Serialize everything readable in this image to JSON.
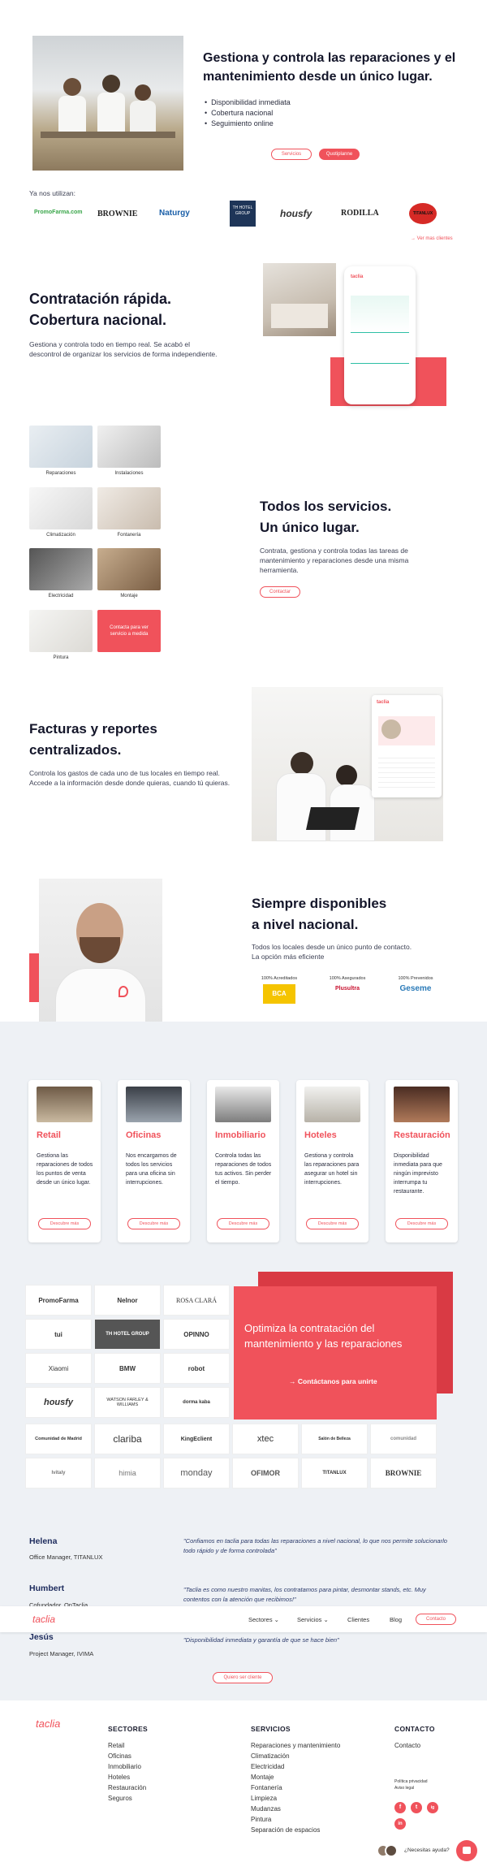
{
  "hero": {
    "title": "Gestiona y controla las reparaciones y el mantenimiento desde un único lugar.",
    "bullets": [
      "Disponibilidad inmediata",
      "Cobertura nacional",
      "Seguimiento online"
    ],
    "btn_services": "Servicios",
    "btn_quote": "Quotiplanne"
  },
  "clients": {
    "label": "Ya nos utilizan:",
    "logos": [
      "PromoFarma.com",
      "BROWNIE",
      "Naturgy",
      "TH HOTEL GROUP",
      "housfy",
      "RODILLA",
      "TITANLUX"
    ],
    "more": "→ Ver mas clientes"
  },
  "s1": {
    "title_1": "Contratación rápida.",
    "title_2": "Cobertura nacional.",
    "text": "Gestiona y controla todo en tiempo real. Se acabó el descontrol de organizar los servicios de forma independiente."
  },
  "services": {
    "items": [
      "Reparaciones",
      "Instalaciones",
      "Climatización",
      "Fontanería",
      "Electricidad",
      "Montaje",
      "Pintura"
    ],
    "contact_tile": "Contacta para ver servicio a medida",
    "title_1": "Todos los servicios.",
    "title_2": "Un único lugar.",
    "text": "Contrata, gestiona y controla todas las tareas de mantenimiento y reparaciones desde una misma herramienta.",
    "btn": "Contactar"
  },
  "reports": {
    "title_1": "Facturas y reportes",
    "title_2": "centralizados.",
    "text": "Controla los gastos de cada uno de tus locales en tiempo real. Accede a la información desde donde quieras, cuando tú quieras."
  },
  "national": {
    "title_1": "Siempre disponibles",
    "title_2": "a nivel nacional.",
    "text_1": "Todos los locales desde un único punto de contacto.",
    "text_2": "La opción más eficiente",
    "badges": [
      {
        "label": "100% Acreditados",
        "logo": "BCA"
      },
      {
        "label": "100% Asegurados",
        "logo": "Plusultra"
      },
      {
        "label": "100% Prevenidos",
        "logo": "Geseme"
      }
    ]
  },
  "sectors": {
    "btn": "Descubre más",
    "cards": [
      {
        "title": "Retail",
        "text": "Gestiona las reparaciones de todos los puntos de venta desde un único lugar."
      },
      {
        "title": "Oficinas",
        "text": "Nos encargamos de todos los servicios para una oficina sin interrupciones."
      },
      {
        "title": "Inmobiliario",
        "text": "Controla todas las reparaciones de todos tus activos. Sin perder el tiempo."
      },
      {
        "title": "Hoteles",
        "text": "Gestiona y controla las reparaciones para asegurar un hotel sin interrupciones."
      },
      {
        "title": "Restauración",
        "text": "Disponibilidad inmediata para que ningún imprevisto interrumpa tu restaurante."
      }
    ]
  },
  "logos_grid": {
    "items": [
      "PromoFarma",
      "Nelnor",
      "ROSA CLARÁ",
      "tui",
      "TH HOTEL GROUP",
      "OPINNO",
      "Xiaomi",
      "BMW",
      "robot",
      "housfy",
      "WATSON FARLEY & WILLIAMS",
      "dorma kaba",
      "Comunidad de Madrid",
      "clariba",
      "KingEclient",
      "xtec",
      "Salón de Belleza",
      "comunidad",
      "Ivitaly",
      "himia",
      "monday",
      "OFIMOR",
      "TITANLUX",
      "BROWNIE"
    ],
    "cta_title": "Optimiza la contratación del mantenimiento y las reparaciones",
    "cta_link": "→ Contáctanos para unirte"
  },
  "testimonials": [
    {
      "name": "Helena",
      "role": "Office Manager, TITANLUX",
      "quote": "\"Confiamos en taclia para todas las reparaciones a nivel nacional, lo que nos permite solucionarlo todo rápido y de forma controlada\""
    },
    {
      "name": "Humbert",
      "role": "Cofundador, OnTaclia",
      "quote": "\"Taclia es como nuestro manitas, los contratamos para pintar, desmontar stands, etc. Muy contentos con la atención que recibimos!\""
    },
    {
      "name": "Jesús",
      "role": "Project Manager, IVIMA",
      "quote": "\"Disponibilidad inmediata y garantía de que se hace bien\""
    }
  ],
  "testimonials_btn": "Quiero ser cliente",
  "nav": {
    "brand": "taclia",
    "items": [
      "Sectores ⌄",
      "Servicios ⌄",
      "Clientes",
      "Blog"
    ],
    "contact": "Contacto"
  },
  "footer": {
    "brand": "taclia",
    "sectores_title": "SECTORES",
    "sectores": [
      "Retail",
      "Oficinas",
      "Inmobiliario",
      "Hoteles",
      "Restauración",
      "Seguros"
    ],
    "servicios_title": "SERVICIOS",
    "servicios": [
      "Reparaciones y mantenimiento",
      "Climatización",
      "Electricidad",
      "Montaje",
      "Fontanería",
      "Limpieza",
      "Mudanzas",
      "Pintura",
      "Separación de espacios"
    ],
    "contacto_title": "CONTACTO",
    "contacto": "Contacto",
    "legal_1": "Política privacidad",
    "legal_2": "Aviso legal",
    "social": [
      "f",
      "t",
      "ig",
      "in"
    ],
    "chat": "¿Necesitas ayuda?"
  },
  "colors": {
    "accent": "#f0525b",
    "navy": "#1c2a5c",
    "gray_bg": "#eef1f5"
  }
}
